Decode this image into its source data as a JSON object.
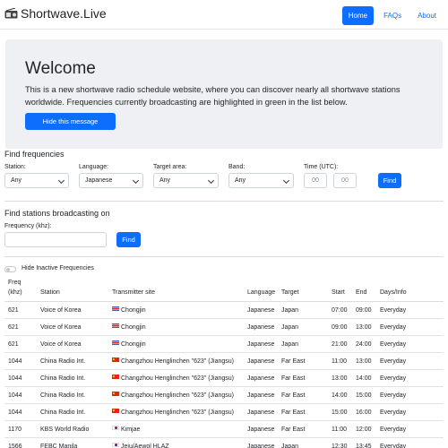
{
  "navbar": {
    "brand": "Shortwave.Live",
    "links": [
      {
        "label": "Home",
        "active": true
      },
      {
        "label": "FAQs",
        "active": false
      },
      {
        "label": "About",
        "active": false
      }
    ]
  },
  "hero": {
    "title": "Welcome",
    "text": "This is a new shortwave radio schedule website, where you can discover nearly all shortwave stations worldwide. Frequencies currently broadcasting are highlighted in green in the list below.",
    "button": "Hide this message"
  },
  "find_frequencies": {
    "title": "Find frequencies",
    "station_label": "Station:",
    "station_value": "Any",
    "language_label": "Language:",
    "language_value": "Japanese",
    "target_label": "Target area:",
    "target_value": "Any",
    "band_label": "Band:",
    "band_value": "Any",
    "time_label": "Time (UTC):",
    "time_hour_placeholder": "00",
    "time_min_placeholder": "00",
    "find_button": "Find"
  },
  "find_stations": {
    "title": "Find stations broadcasting on",
    "freq_label": "Frequency (khz):",
    "freq_value": "",
    "find_button": "Find"
  },
  "toggle": {
    "label": "Hide Inactive Frequencies",
    "checked": false
  },
  "table": {
    "headers": {
      "freq_line1": "Freq",
      "freq_line2": "(khz)",
      "station": "Station",
      "site": "Transmitter site",
      "language": "Language",
      "target": "Target",
      "start": "Start",
      "end": "End",
      "days": "Days/Info"
    },
    "rows": [
      {
        "freq": "621",
        "station": "Voice of Korea",
        "flag": "kp",
        "site": "Chongjin",
        "language": "Japanese",
        "target": "Japan",
        "start": "07:00",
        "end": "09:00",
        "days": "Everyday"
      },
      {
        "freq": "621",
        "station": "Voice of Korea",
        "flag": "kp",
        "site": "Chongjin",
        "language": "Japanese",
        "target": "Japan",
        "start": "09:00",
        "end": "13:00",
        "days": "Everyday"
      },
      {
        "freq": "621",
        "station": "Voice of Korea",
        "flag": "kp",
        "site": "Chongjin",
        "language": "Japanese",
        "target": "Japan",
        "start": "21:00",
        "end": "24:00",
        "days": "Everyday"
      },
      {
        "freq": "1044",
        "station": "China Radio Int.",
        "flag": "cn",
        "site": "Changzhou Henglinchen \"623\" (Jiangsu)",
        "language": "Japanese",
        "target": "Far East",
        "start": "11:00",
        "end": "13:00",
        "days": "Everyday"
      },
      {
        "freq": "1044",
        "station": "China Radio Int.",
        "flag": "cn",
        "site": "Changzhou Henglinchen \"623\" (Jiangsu)",
        "language": "Japanese",
        "target": "Far East",
        "start": "13:00",
        "end": "14:00",
        "days": "Everyday"
      },
      {
        "freq": "1044",
        "station": "China Radio Int.",
        "flag": "cn",
        "site": "Changzhou Henglinchen \"623\" (Jiangsu)",
        "language": "Japanese",
        "target": "Far East",
        "start": "14:00",
        "end": "15:00",
        "days": "Everyday"
      },
      {
        "freq": "1044",
        "station": "China Radio Int.",
        "flag": "cn",
        "site": "Changzhou Henglinchen \"623\" (Jiangsu)",
        "language": "Japanese",
        "target": "Far East",
        "start": "15:00",
        "end": "16:00",
        "days": "Everyday"
      },
      {
        "freq": "1170",
        "station": "KBS World Radio",
        "flag": "kr",
        "site": "Kimjae",
        "language": "Japanese",
        "target": "Far East",
        "start": "11:00",
        "end": "12:00",
        "days": "Everyday"
      },
      {
        "freq": "1566",
        "station": "FEBC Manila",
        "flag": "kr",
        "site": "Jeju/Aewol HLAZ",
        "language": "Japanese",
        "target": "Japan",
        "start": "12:30",
        "end": "13:45",
        "days": "Everyday"
      }
    ]
  }
}
